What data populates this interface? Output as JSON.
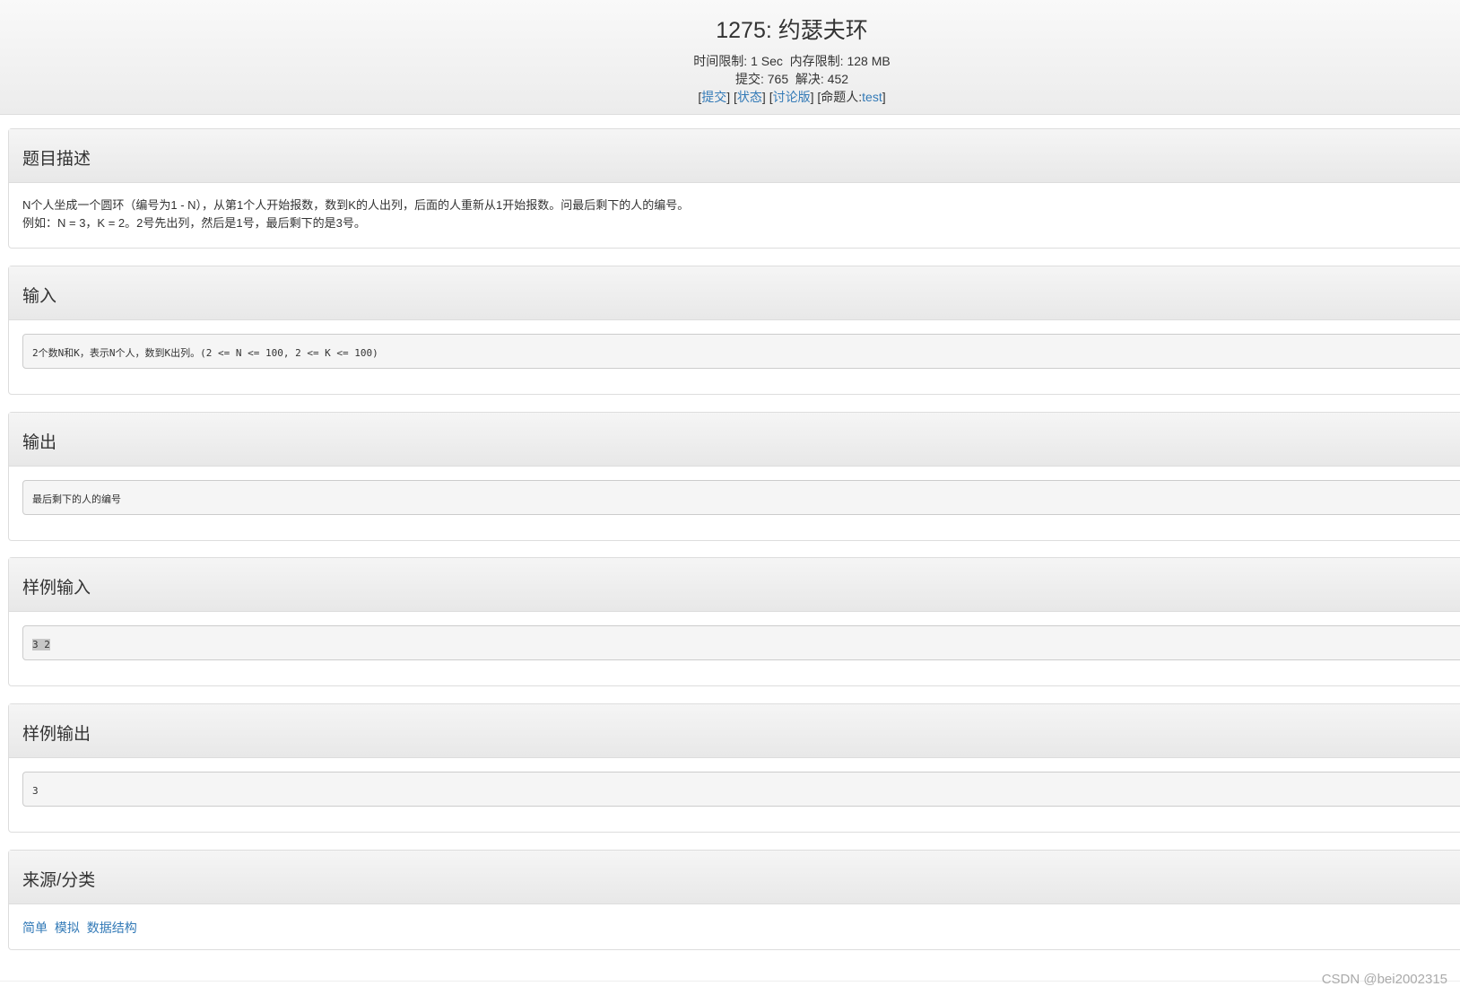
{
  "header": {
    "title": "1275: 约瑟夫环",
    "time_limit_label": "时间限制:",
    "time_limit": "1 Sec",
    "memory_limit_label": "内存限制:",
    "memory_limit": "128 MB",
    "submit_label": "提交:",
    "submit_count": "765",
    "solved_label": "解决:",
    "solved_count": "452",
    "links": {
      "submit": "提交",
      "status": "状态",
      "discuss": "讨论版",
      "author_label": "命题人:",
      "author": "test"
    }
  },
  "sections": {
    "description": {
      "title": "题目描述",
      "line1": "N个人坐成一个圆环（编号为1 - N），从第1个人开始报数，数到K的人出列，后面的人重新从1开始报数。问最后剩下的人的编号。",
      "line2": "例如：N = 3，K = 2。2号先出列，然后是1号，最后剩下的是3号。"
    },
    "input": {
      "title": "输入",
      "content": "2个数N和K，表示N个人，数到K出列。(2 <= N <= 100, 2 <= K <= 100)"
    },
    "output": {
      "title": "输出",
      "content": "最后剩下的人的编号"
    },
    "sample_input": {
      "title": "样例输入",
      "content": "3 2"
    },
    "sample_output": {
      "title": "样例输出",
      "content": "3"
    },
    "source": {
      "title": "来源/分类",
      "tags": [
        "简单",
        "模拟",
        "数据结构"
      ]
    }
  },
  "watermark": "CSDN @bei2002315"
}
